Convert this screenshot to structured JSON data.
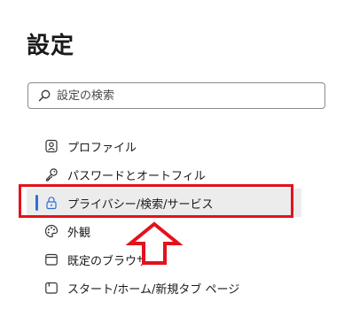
{
  "header": {
    "title": "設定"
  },
  "search": {
    "placeholder": "設定の検索",
    "icon": "search-icon"
  },
  "nav": {
    "items": [
      {
        "label": "プロファイル",
        "icon": "profile-icon"
      },
      {
        "label": "パスワードとオートフィル",
        "icon": "key-icon"
      },
      {
        "label": "プライバシー/検索/サービス",
        "icon": "lock-icon",
        "active": true
      },
      {
        "label": "外観",
        "icon": "palette-icon"
      },
      {
        "label": "既定のブラウザー",
        "icon": "browser-icon"
      },
      {
        "label": "スタート/ホーム/新規タブ ページ",
        "icon": "home-page-icon"
      }
    ]
  },
  "annotation": {
    "highlight_color": "#e3121c",
    "arrow_color": "#e3121c"
  },
  "colors": {
    "active_bar": "#2f6fd6",
    "active_bg": "#ececec"
  }
}
